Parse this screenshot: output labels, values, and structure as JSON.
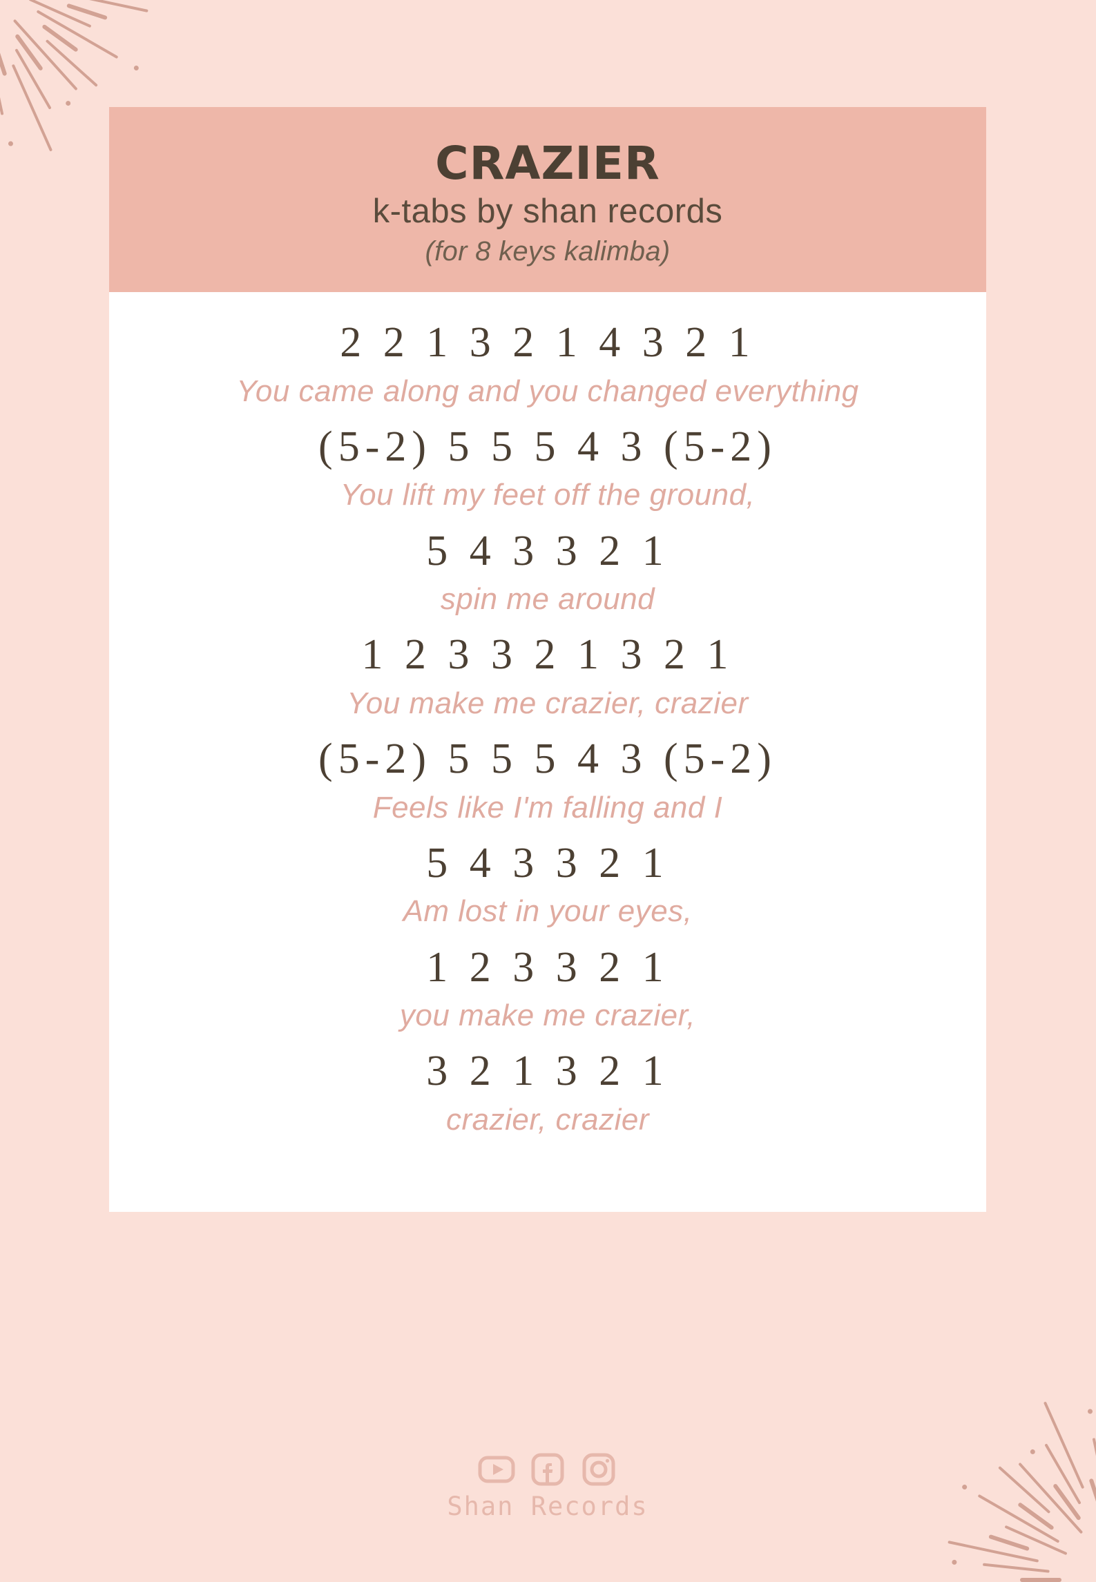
{
  "colors": {
    "page_background": "#fbe0d8",
    "header_band": "#eeb7a9",
    "sheet_background": "#ffffff",
    "tab_text": "#4c4033",
    "lyric_text": "#e0aba0",
    "decor": "#d2a294",
    "brand": "#e6b8ac"
  },
  "header": {
    "title": "CRAZIER",
    "credit": "k-tabs by shan records",
    "instrument": "(for 8 keys kalimba)"
  },
  "tab_sheet": {
    "lines": [
      {
        "type": "tab",
        "text": "2 2 1 3 2 1 4 3 2 1"
      },
      {
        "type": "lyric",
        "text": "You came along and you changed everything"
      },
      {
        "type": "tab",
        "text": "(5-2) 5 5 5 4 3 (5-2)"
      },
      {
        "type": "lyric",
        "text": "You lift my feet off the ground,"
      },
      {
        "type": "tab",
        "text": "5 4 3 3 2 1"
      },
      {
        "type": "lyric",
        "text": "spin me around"
      },
      {
        "type": "tab",
        "text": "1 2 3 3 2 1 3 2 1"
      },
      {
        "type": "lyric",
        "text": "You make me crazier, crazier"
      },
      {
        "type": "tab",
        "text": "(5-2) 5 5 5 4 3 (5-2)"
      },
      {
        "type": "lyric",
        "text": "Feels like I'm falling and I"
      },
      {
        "type": "tab",
        "text": "5 4 3 3 2 1"
      },
      {
        "type": "lyric",
        "text": "Am lost in your eyes,"
      },
      {
        "type": "tab",
        "text": "1 2 3 3 2 1"
      },
      {
        "type": "lyric",
        "text": "you make me crazier,"
      },
      {
        "type": "tab",
        "text": "3 2 1 3 2 1"
      },
      {
        "type": "lyric",
        "text": "crazier, crazier"
      }
    ]
  },
  "footer": {
    "brand": "Shan Records",
    "socials": [
      {
        "icon": "youtube-icon",
        "label": "YouTube"
      },
      {
        "icon": "facebook-icon",
        "label": "Facebook"
      },
      {
        "icon": "instagram-icon",
        "label": "Instagram"
      }
    ]
  }
}
